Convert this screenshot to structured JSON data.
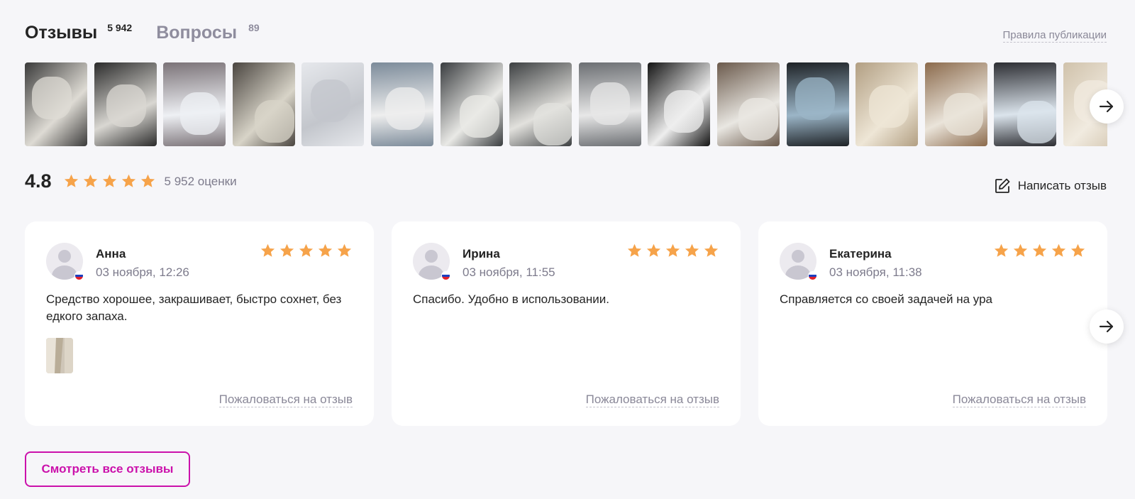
{
  "tabs": [
    {
      "label": "Отзывы",
      "count": "5 942",
      "active": true
    },
    {
      "label": "Вопросы",
      "count": "89",
      "active": false
    }
  ],
  "rules_link": "Правила публикации",
  "gallery": {
    "photos": [
      {
        "colors": [
          "#3a3a3a",
          "#dedbd4"
        ]
      },
      {
        "colors": [
          "#2b2b2b",
          "#d9d7d2"
        ]
      },
      {
        "colors": [
          "#7b7378",
          "#eef0f4"
        ]
      },
      {
        "colors": [
          "#4a4540",
          "#d8d4c8"
        ]
      },
      {
        "colors": [
          "#e6e8ec",
          "#c3c6cc"
        ]
      },
      {
        "colors": [
          "#7c8b9a",
          "#eeeeee"
        ]
      },
      {
        "colors": [
          "#3a3d40",
          "#e9e9e6"
        ]
      },
      {
        "colors": [
          "#3d4042",
          "#e2e1dd"
        ]
      },
      {
        "colors": [
          "#6c6f73",
          "#e7e7e7"
        ]
      },
      {
        "colors": [
          "#141414",
          "#eeeeee"
        ]
      },
      {
        "colors": [
          "#6b5a4c",
          "#e9e7e2"
        ]
      },
      {
        "colors": [
          "#1e2226",
          "#9bb5c7"
        ]
      },
      {
        "colors": [
          "#b29f83",
          "#eee6d6"
        ]
      },
      {
        "colors": [
          "#8b6a4c",
          "#eae4da"
        ]
      },
      {
        "colors": [
          "#2d2e33",
          "#dbe4ec"
        ]
      },
      {
        "colors": [
          "#d0c2ab",
          "#f1ebe0"
        ]
      }
    ]
  },
  "rating": {
    "value": "4.8",
    "count_text": "5 952 оценки",
    "stars": 5,
    "star_color": "#f6a34a"
  },
  "write_review": "Написать отзыв",
  "reviews": [
    {
      "author": "Анна",
      "date": "03 ноября, 12:26",
      "stars": 5,
      "text": "Средство хорошее, закрашивает, быстро сохнет, без едкого запаха.",
      "has_photo": true,
      "report": "Пожаловаться на отзыв"
    },
    {
      "author": "Ирина",
      "date": "03 ноября, 11:55",
      "stars": 5,
      "text": "Спасибо. Удобно в использовании.",
      "has_photo": false,
      "report": "Пожаловаться на отзыв"
    },
    {
      "author": "Екатерина",
      "date": "03 ноября, 11:38",
      "stars": 5,
      "text": "Справляется со своей задачей на ура",
      "has_photo": false,
      "report": "Пожаловаться на отзыв"
    }
  ],
  "all_reviews_button": "Смотреть все отзывы",
  "colors": {
    "accent": "#cb11ab",
    "star": "#f6a34a",
    "muted": "#8f8d9e"
  }
}
